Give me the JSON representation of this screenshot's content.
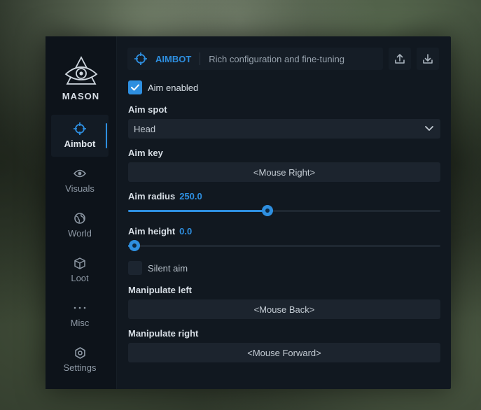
{
  "brand": {
    "name": "MASON"
  },
  "sidebar": {
    "items": [
      {
        "label": "Aimbot",
        "icon": "crosshair-icon",
        "active": true
      },
      {
        "label": "Visuals",
        "icon": "eye-icon",
        "active": false
      },
      {
        "label": "World",
        "icon": "globe-icon",
        "active": false
      },
      {
        "label": "Loot",
        "icon": "box-icon",
        "active": false
      },
      {
        "label": "Misc",
        "icon": "more-dots-icon",
        "active": false
      },
      {
        "label": "Settings",
        "icon": "gear-icon",
        "active": false
      }
    ]
  },
  "header": {
    "title": "AIMBOT",
    "description": "Rich configuration and fine-tuning",
    "upload_icon": "upload-icon",
    "download_icon": "download-icon"
  },
  "settings": {
    "aim_enabled": {
      "label": "Aim enabled",
      "checked": true
    },
    "aim_spot": {
      "label": "Aim spot",
      "value": "Head"
    },
    "aim_key": {
      "label": "Aim key",
      "value": "<Mouse Right>"
    },
    "aim_radius": {
      "label": "Aim radius",
      "value": "250.0",
      "fraction": 0.445
    },
    "aim_height": {
      "label": "Aim height",
      "value": "0.0",
      "fraction": 0.0
    },
    "silent_aim": {
      "label": "Silent aim",
      "checked": false
    },
    "manipulate_left": {
      "label": "Manipulate left",
      "value": "<Mouse Back>"
    },
    "manipulate_right": {
      "label": "Manipulate right",
      "value": "<Mouse Forward>"
    }
  },
  "colors": {
    "accent": "#2e8fe0",
    "panel": "#111820",
    "sidebar": "#0d131a",
    "control": "#1c242e"
  }
}
